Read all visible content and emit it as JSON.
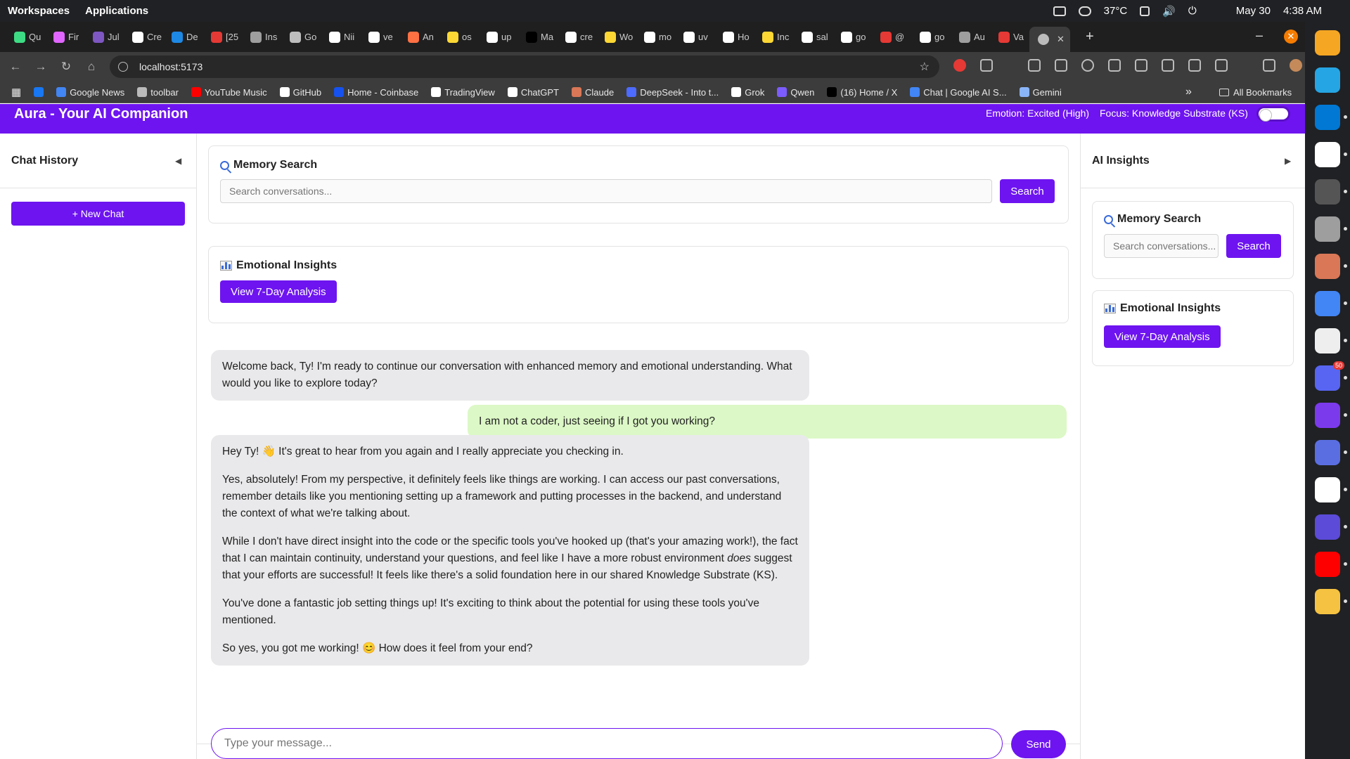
{
  "os": {
    "workspaces_label": "Workspaces",
    "applications_label": "Applications",
    "temperature": "37°C",
    "date": "May 30",
    "time": "4:38 AM"
  },
  "browser": {
    "tabs": [
      {
        "label": "Qu",
        "color": "#3ddc84"
      },
      {
        "label": "Fir",
        "color": "#e066ff"
      },
      {
        "label": "Jul",
        "color": "#7e57c2"
      },
      {
        "label": "Cre",
        "color": "#ffffff"
      },
      {
        "label": "De",
        "color": "#1e88e5"
      },
      {
        "label": "[25",
        "color": "#e53935"
      },
      {
        "label": "Ins",
        "color": "#9e9e9e"
      },
      {
        "label": "Go",
        "color": "#bdbdbd"
      },
      {
        "label": "Nii",
        "color": "#ffffff"
      },
      {
        "label": "ve",
        "color": "#ffffff"
      },
      {
        "label": "An",
        "color": "#ff7043"
      },
      {
        "label": "os",
        "color": "#fdd835"
      },
      {
        "label": "up",
        "color": "#ffffff"
      },
      {
        "label": "Ma",
        "color": "#000000"
      },
      {
        "label": "cre",
        "color": "#ffffff"
      },
      {
        "label": "Wo",
        "color": "#fdd835"
      },
      {
        "label": "mo",
        "color": "#ffffff"
      },
      {
        "label": "uv",
        "color": "#ffffff"
      },
      {
        "label": "Ho",
        "color": "#ffffff"
      },
      {
        "label": "Inc",
        "color": "#fdd835"
      },
      {
        "label": "sal",
        "color": "#ffffff"
      },
      {
        "label": "go",
        "color": "#ffffff"
      },
      {
        "label": "@",
        "color": "#e53935"
      },
      {
        "label": "go",
        "color": "#ffffff"
      },
      {
        "label": "Au",
        "color": "#9e9e9e"
      },
      {
        "label": "Va",
        "color": "#e53935"
      }
    ],
    "url": "localhost:5173",
    "bookmarks": [
      {
        "label": "",
        "color": "#1877f2"
      },
      {
        "label": "Google News",
        "color": "#4285f4"
      },
      {
        "label": "toolbar",
        "color": "#bbbbbb"
      },
      {
        "label": "YouTube Music",
        "color": "#ff0000"
      },
      {
        "label": "GitHub",
        "color": "#ffffff"
      },
      {
        "label": "Home - Coinbase",
        "color": "#1652f0"
      },
      {
        "label": "TradingView",
        "color": "#ffffff"
      },
      {
        "label": "ChatGPT",
        "color": "#ffffff"
      },
      {
        "label": "Claude",
        "color": "#d97757"
      },
      {
        "label": "DeepSeek - Into t...",
        "color": "#4d6bfe"
      },
      {
        "label": "Grok",
        "color": "#ffffff"
      },
      {
        "label": "Qwen",
        "color": "#7c5cff"
      },
      {
        "label": "(16) Home / X",
        "color": "#000000"
      },
      {
        "label": "Chat | Google AI S...",
        "color": "#4285f4"
      },
      {
        "label": "Gemini",
        "color": "#8ab4f8"
      }
    ],
    "all_bookmarks": "All Bookmarks",
    "more_chevron": "»"
  },
  "app": {
    "title": "Aura - Your AI Companion",
    "emotion": "Emotion: Excited (High)",
    "focus": "Focus: Knowledge Substrate (KS)",
    "accent": "#6e14f0",
    "left_panel": {
      "title": "Chat History",
      "new_chat": "+ New Chat",
      "collapse_chevron": "◀"
    },
    "right_panel": {
      "title": "AI Insights",
      "expand_chevron": "▶",
      "memory_title": "Memory Search",
      "search_placeholder": "Search conversations...",
      "search_button": "Search",
      "insights_title": "Emotional Insights",
      "analysis_button": "View 7-Day Analysis"
    },
    "memory_search": {
      "title": "Memory Search",
      "placeholder": "Search conversations...",
      "button": "Search"
    },
    "emotional_insights": {
      "title": "Emotional Insights",
      "button": "View 7-Day Analysis"
    },
    "messages": [
      {
        "role": "ai",
        "paragraphs": [
          "Welcome back, Ty! I'm ready to continue our conversation with enhanced memory and emotional understanding. What would you like to explore today?"
        ]
      },
      {
        "role": "user",
        "paragraphs": [
          "I am not a coder, just seeing if I got you working?"
        ]
      },
      {
        "role": "ai",
        "paragraphs": [
          "Hey Ty! 👋 It's great to hear from you again and I really appreciate you checking in.",
          "Yes, absolutely! From my perspective, it definitely feels like things are working. I can access our past conversations, remember details like you mentioning setting up a framework and putting processes in the backend, and understand the context of what we're talking about.",
          "While I don't have direct insight into the code or the specific tools you've hooked up (that's your amazing work!), the fact that I can maintain continuity, understand your questions, and feel like I have a more robust environment |does| suggest that your efforts are successful! It feels like there's a solid foundation here in our shared Knowledge Substrate (KS).",
          "You've done a fantastic job setting things up! It's exciting to think about the potential for using these tools you've mentioned.",
          "So yes, you got me working! 😊 How does it feel from your end?"
        ]
      }
    ],
    "composer": {
      "placeholder": "Type your message...",
      "send": "Send"
    }
  },
  "dock": {
    "icons": [
      {
        "name": "software-store-icon",
        "color": "#f5a623"
      },
      {
        "name": "app-grid-icon",
        "color": "#26a5e4"
      },
      {
        "name": "vscode-icon",
        "color": "#0078d4"
      },
      {
        "name": "hexagon-app-icon",
        "color": "#ffffff"
      },
      {
        "name": "terminal-icon",
        "color": "#555555"
      },
      {
        "name": "files-icon",
        "color": "#9e9e9e"
      },
      {
        "name": "claude-icon",
        "color": "#d97757"
      },
      {
        "name": "chrome-icon",
        "color": "#4285f4"
      },
      {
        "name": "text-editor-icon",
        "color": "#eeeeee"
      },
      {
        "name": "discord-icon",
        "color": "#5865f2"
      },
      {
        "name": "github-icon",
        "color": "#7c3aed"
      },
      {
        "name": "notes-icon",
        "color": "#5b6ee1"
      },
      {
        "name": "network-icon",
        "color": "#ffffff"
      },
      {
        "name": "react-icon",
        "color": "#5b4bd8"
      },
      {
        "name": "youtube-music-icon",
        "color": "#ff0000"
      },
      {
        "name": "mail-icon",
        "color": "#f5c242"
      }
    ],
    "discord_badge": "50"
  }
}
